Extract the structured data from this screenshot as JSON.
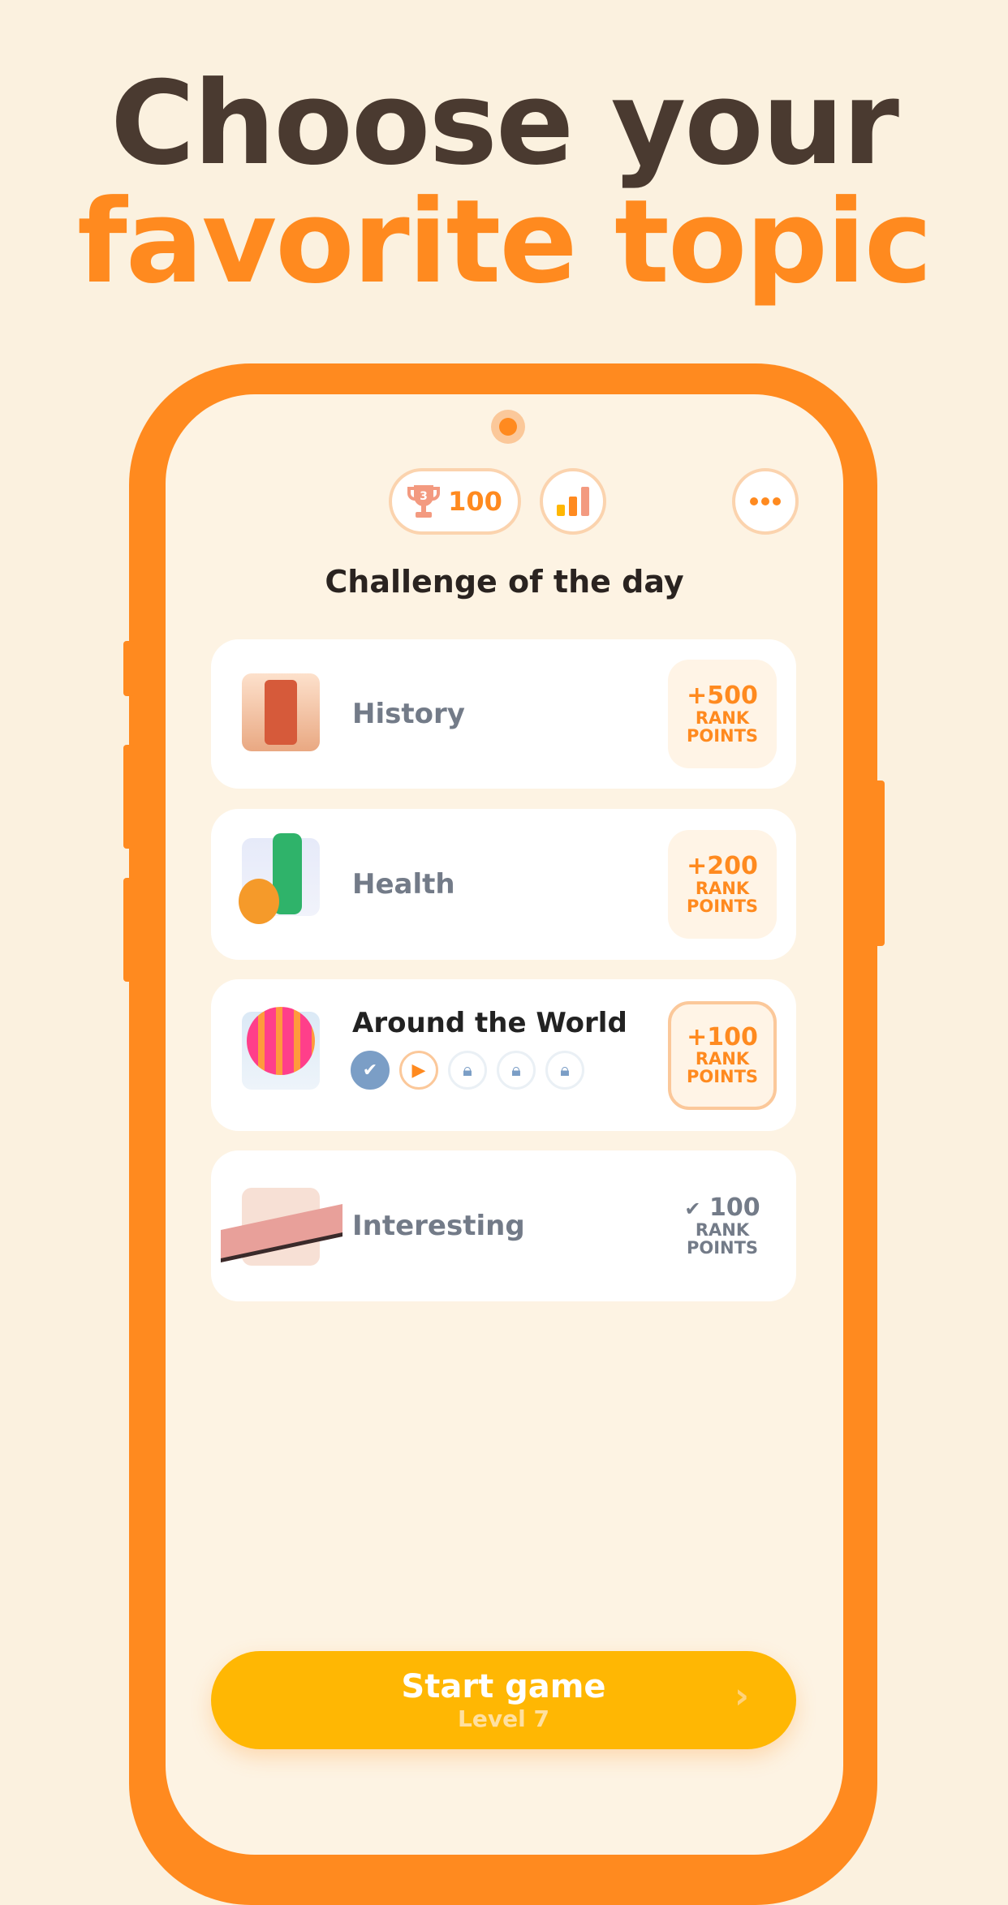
{
  "headline": {
    "line1": "Choose your",
    "line2": "favorite topic"
  },
  "header": {
    "trophy_rank": "3",
    "trophy_score": "100",
    "stats_icon": "bar-chart-icon",
    "menu_icon": "more-dots-icon"
  },
  "section_title": "Challenge of the day",
  "topics": [
    {
      "name": "History",
      "points": "+500",
      "points_label1": "RANK",
      "points_label2": "POINTS",
      "state": "available"
    },
    {
      "name": "Health",
      "points": "+200",
      "points_label1": "RANK",
      "points_label2": "POINTS",
      "state": "available"
    },
    {
      "name": "Around the World",
      "points": "+100",
      "points_label1": "RANK",
      "points_label2": "POINTS",
      "state": "selected",
      "steps": [
        "completed",
        "current",
        "locked",
        "locked",
        "locked"
      ]
    },
    {
      "name": "Interesting",
      "points": "100",
      "points_label1": "RANK",
      "points_label2": "POINTS",
      "state": "completed"
    }
  ],
  "start": {
    "label": "Start game",
    "sublabel": "Level 7"
  },
  "colors": {
    "accent": "#ff8a1f",
    "button": "#ffb703",
    "title": "#4a3a30",
    "completed": "#7b9ec6"
  }
}
